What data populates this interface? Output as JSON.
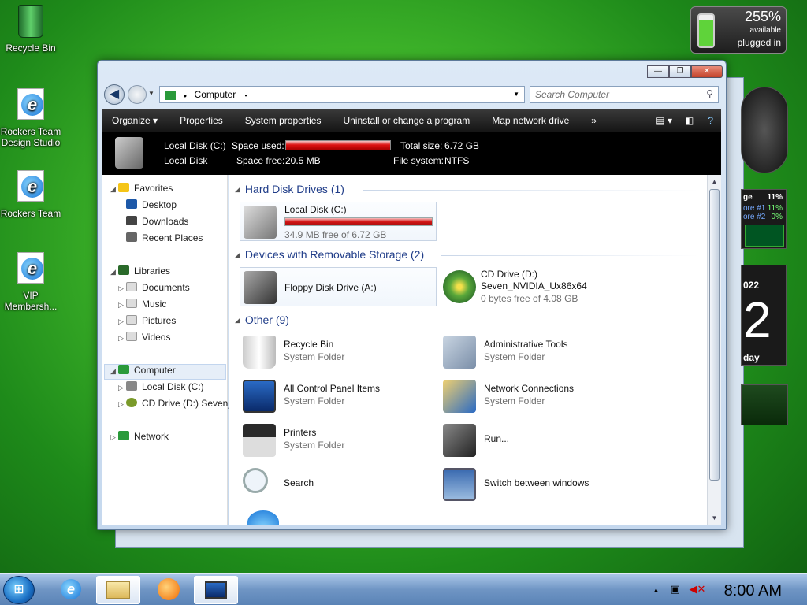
{
  "desktop": {
    "icons": [
      {
        "label": "Recycle Bin",
        "icon": "recycle-bin-icon"
      },
      {
        "label": "Rockers Team Design Studio",
        "icon": "internet-explorer-icon"
      },
      {
        "label": "Rockers Team",
        "icon": "internet-explorer-icon"
      },
      {
        "label": "VIP Membersh...",
        "icon": "internet-explorer-icon"
      }
    ],
    "battery_gadget": {
      "percent": "255%",
      "available": "available",
      "status": "plugged in"
    },
    "cpu_gadget": {
      "total": "11%",
      "core1_label": "ore #1",
      "core1": "11%",
      "core2_label": "ore #2",
      "core2": "0%",
      "label": "ge"
    },
    "calendar_gadget": {
      "year": "022",
      "day": "2",
      "weekday": "day"
    }
  },
  "window": {
    "title_buttons": {
      "minimize": "—",
      "maximize": "❐",
      "close": "✕"
    },
    "address": {
      "crumb": "Computer",
      "separator_after": "•"
    },
    "search": {
      "placeholder": "Search Computer"
    },
    "toolbar": {
      "organize": "Organize ▾",
      "properties": "Properties",
      "system_properties": "System properties",
      "uninstall": "Uninstall or change a program",
      "map_drive": "Map network drive",
      "more": "»"
    },
    "details": {
      "name": "Local Disk (C:)",
      "type": "Local Disk",
      "space_used_label": "Space used:",
      "space_free_label": "Space free:",
      "space_free": "20.5 MB",
      "total_size_label": "Total size:",
      "total_size": "6.72 GB",
      "file_system_label": "File system:",
      "file_system": "NTFS",
      "used_fraction": 0.997
    },
    "nav": {
      "favorites": "Favorites",
      "desktop": "Desktop",
      "downloads": "Downloads",
      "recent_places": "Recent Places",
      "libraries": "Libraries",
      "documents": "Documents",
      "music": "Music",
      "pictures": "Pictures",
      "videos": "Videos",
      "computer": "Computer",
      "local_disk": "Local Disk (C:)",
      "cd_drive": "CD Drive (D:) Seven_",
      "network": "Network"
    },
    "content": {
      "groups": {
        "hard_disk": "Hard Disk Drives (1)",
        "removable": "Devices with Removable Storage (2)",
        "other": "Other (9)"
      },
      "local_disk": {
        "name": "Local Disk (C:)",
        "free": "34.9 MB free of 6.72 GB",
        "used_fraction": 0.995
      },
      "floppy": {
        "name": "Floppy Disk Drive (A:)"
      },
      "cd_drive": {
        "name": "CD Drive (D:)",
        "label": "Seven_NVIDIA_Ux86x64",
        "free": "0 bytes free of 4.08 GB"
      },
      "other_items": [
        {
          "name": "Recycle Bin",
          "sub": "System Folder"
        },
        {
          "name": "Administrative Tools",
          "sub": "System Folder"
        },
        {
          "name": "All Control Panel Items",
          "sub": "System Folder"
        },
        {
          "name": "Network Connections",
          "sub": "System Folder"
        },
        {
          "name": "Printers",
          "sub": "System Folder"
        },
        {
          "name": "Run...",
          "sub": ""
        },
        {
          "name": "Search",
          "sub": ""
        },
        {
          "name": "Switch between windows",
          "sub": ""
        }
      ]
    }
  },
  "taskbar": {
    "clock": "8:00 AM",
    "tray_arrow": "▲",
    "accent": "#6f95c4"
  }
}
